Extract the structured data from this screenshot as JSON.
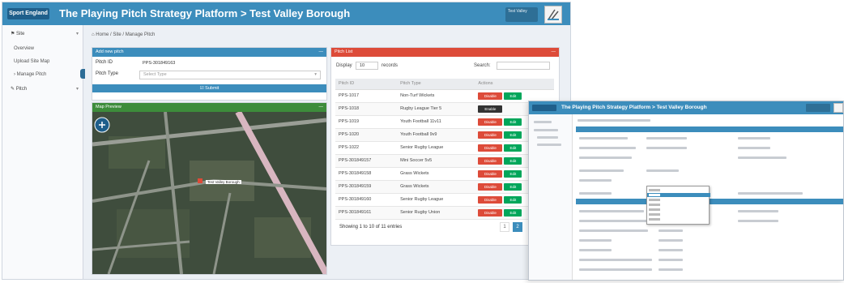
{
  "app": {
    "logo_text": "Sport England",
    "title": "The Playing Pitch Strategy Platform > Test Valley Borough",
    "user_label": "Test Valley",
    "colors": {
      "primary": "#3c8dbc",
      "map_header": "#3d8c3b",
      "list_header": "#dd4b39",
      "disable": "#dd4b39",
      "edit": "#00a65a"
    }
  },
  "sidebar": {
    "items": [
      {
        "label": "Site",
        "icon": "map-icon"
      },
      {
        "label": "Overview"
      },
      {
        "label": "Upload Site Map"
      },
      {
        "label": "Manage Pitch"
      },
      {
        "label": "Pitch",
        "icon": "edit-icon"
      }
    ]
  },
  "breadcrumb": {
    "home": "Home",
    "site": "Site",
    "current": "Manage Pitch"
  },
  "add_pitch": {
    "header": "Add new pitch",
    "pitch_id_label": "Pitch ID",
    "pitch_id_value": "PPS-301849163",
    "pitch_type_label": "Pitch Type",
    "pitch_type_placeholder": "Select Type",
    "submit_label": "Submit"
  },
  "map_preview": {
    "header": "Map Preview",
    "marker_label": "Test Valley Borough"
  },
  "pitch_list": {
    "header": "Pitch List",
    "display_label": "Display",
    "display_value": "10",
    "records_label": "records",
    "search_label": "Search:",
    "columns": [
      "Pitch ID",
      "Pitch Type",
      "Actions"
    ],
    "disable_label": "Disable",
    "enable_label": "Enable",
    "edit_label": "Edit",
    "rows": [
      {
        "id": "PPS-1017",
        "type": "Non-Turf Wickets",
        "state": "active"
      },
      {
        "id": "PPS-1018",
        "type": "Rugby League Tier 5",
        "state": "disabled"
      },
      {
        "id": "PPS-1019",
        "type": "Youth Football 11v11",
        "state": "active"
      },
      {
        "id": "PPS-1020",
        "type": "Youth Football 9v9",
        "state": "active"
      },
      {
        "id": "PPS-1022",
        "type": "Senior Rugby League",
        "state": "active"
      },
      {
        "id": "PPS-301849157",
        "type": "Mini Soccer 5v5",
        "state": "active"
      },
      {
        "id": "PPS-301849158",
        "type": "Grass Wickets",
        "state": "active"
      },
      {
        "id": "PPS-301849159",
        "type": "Grass Wickets",
        "state": "active"
      },
      {
        "id": "PPS-301849160",
        "type": "Senior Rugby League",
        "state": "active"
      },
      {
        "id": "PPS-301849161",
        "type": "Senior Rugby Union",
        "state": "active"
      }
    ],
    "showing_text": "Showing 1 to 10 of 11 entries",
    "pages": [
      "1",
      "2"
    ]
  },
  "inset": {
    "title": "The Playing Pitch Strategy Platform > Test Valley Borough"
  }
}
